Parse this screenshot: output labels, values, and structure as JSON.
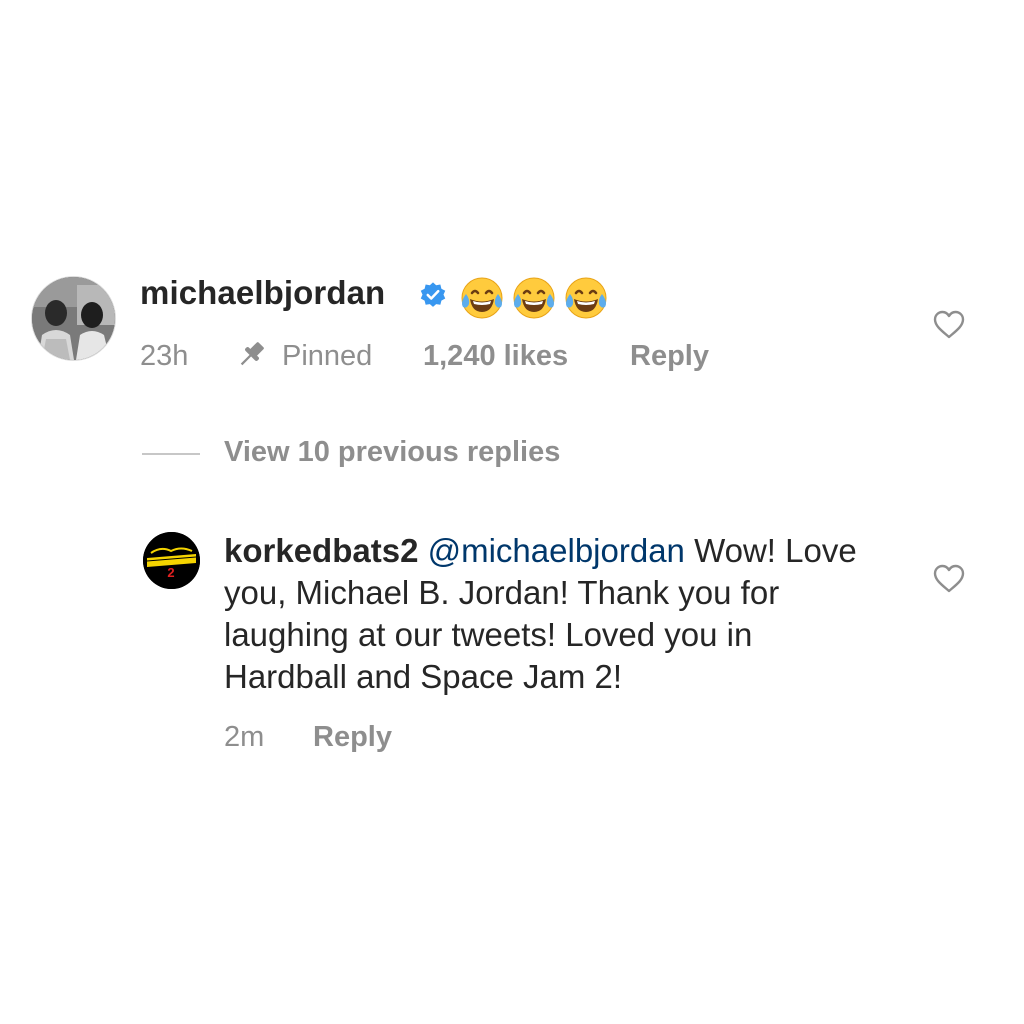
{
  "comment": {
    "username": "michaelbjordan",
    "verified": true,
    "emojis": [
      "face-with-tears-of-joy",
      "face-with-tears-of-joy",
      "face-with-tears-of-joy"
    ],
    "time": "23h",
    "pinned_label": "Pinned",
    "likes": "1,240 likes",
    "reply_label": "Reply"
  },
  "view_replies": {
    "label": "View 10 previous replies"
  },
  "reply": {
    "username": "korkedbats2",
    "mention": "@michaelbjordan",
    "text": " Wow! Love you, Michael B. Jordan! Thank you for laughing at our tweets! Loved you in Hardball and Space Jam 2!",
    "time": "2m",
    "reply_label": "Reply"
  },
  "colors": {
    "text_primary": "#262626",
    "text_secondary": "#8e8e8e",
    "mention": "#00376b",
    "verified_badge": "#3897f0",
    "emoji_face": "#ffcb3d",
    "emoji_tears": "#5dadec"
  }
}
